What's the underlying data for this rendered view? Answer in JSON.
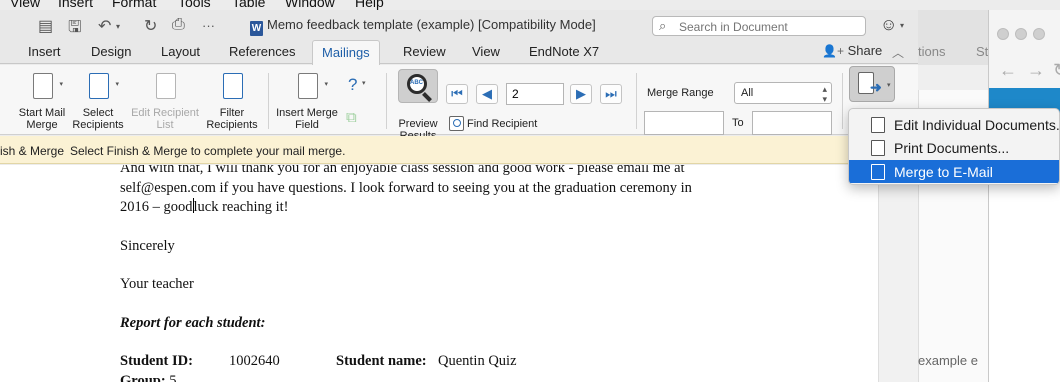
{
  "menubar": {
    "items": [
      "View",
      "Insert",
      "Format",
      "Tools",
      "Table",
      "Window",
      "Help"
    ]
  },
  "window": {
    "title": "Memo feedback template (example) [Compatibility Mode]",
    "search_placeholder": "Search in Document"
  },
  "tabs": {
    "items": [
      "Insert",
      "Design",
      "Layout",
      "References",
      "Mailings",
      "Review",
      "View",
      "EndNote X7"
    ],
    "active": "Mailings",
    "share_label": "Share"
  },
  "ribbon": {
    "start_mail_merge": "Start Mail Merge",
    "select_recipients": "Select Recipients",
    "edit_recipient_list": "Edit Recipient List",
    "filter_recipients": "Filter Recipients",
    "insert_merge_field": "Insert Merge Field",
    "preview_results": "Preview Results",
    "record_number": "2",
    "find_recipient": "Find Recipient",
    "merge_range_label": "Merge Range",
    "merge_range_value": "All",
    "to_label": "To"
  },
  "message_bar": {
    "title": "ish & Merge",
    "message": "Select Finish & Merge to complete your mail merge."
  },
  "finish_menu": {
    "items": [
      "Edit Individual Documents...",
      "Print Documents...",
      "Merge to E-Mail"
    ],
    "highlighted": "Merge to E-Mail"
  },
  "document": {
    "line1": "And with that, I will thank you for an enjoyable class session and good work - please email me at",
    "line2": "self@espen.com if you have questions. I look forward to seeing you at the graduation ceremony in",
    "line3a": "2016 – good",
    "line3b": "luck reaching it!",
    "closing": "Sincerely",
    "signature": "Your teacher",
    "report_heading": "Report for each student:",
    "student_id_label": "Student ID:",
    "student_id_value": "1002640",
    "student_name_label": "Student name:",
    "student_name_value": "Quentin Quiz",
    "group_label": "Group:",
    "group_value": "5"
  },
  "background": {
    "tab_fragment": "tions",
    "tab_fragment2": "St",
    "example_fragment": "example e"
  },
  "colors": {
    "accent": "#1f5fa8",
    "menu_highlight": "#1a6ed8",
    "message_bar": "#fbf2d4"
  }
}
